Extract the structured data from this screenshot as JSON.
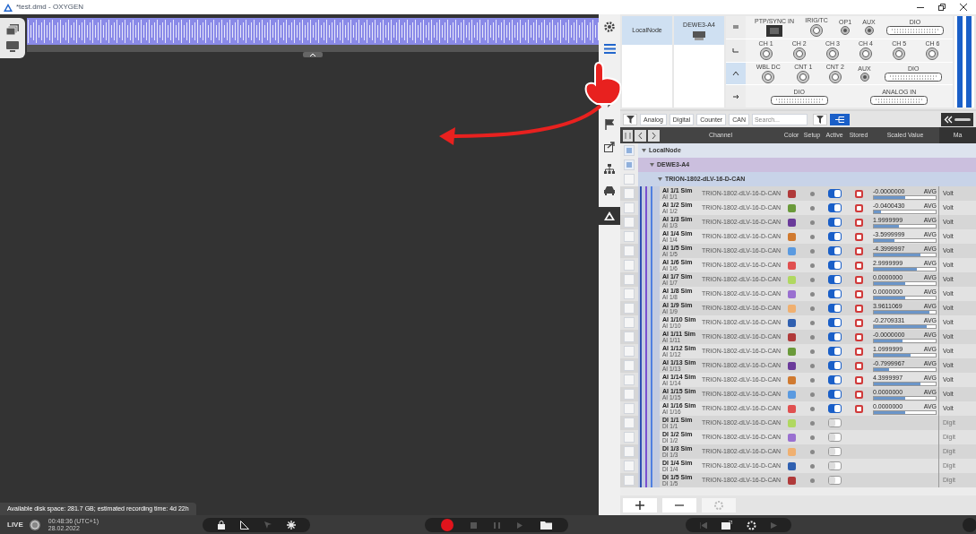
{
  "window": {
    "title": "*test.dmd - OXYGEN"
  },
  "status_text": "Available disk space: 281.7 GB; estimated recording time: 4d 22h",
  "bottom_bar": {
    "live": "LIVE",
    "time": "00:48:36 (UTC+1)",
    "date": "28.02.2022"
  },
  "hardware": {
    "nodes": [
      {
        "label": "LocalNode",
        "selected": true
      },
      {
        "label": "DEWE3-A4",
        "selected": true
      }
    ],
    "slots": [
      {
        "selected": false,
        "connectors": [
          {
            "kind": "ethernet",
            "label": "PTP/SYNC IN"
          },
          {
            "kind": "round",
            "label": "IRIG/TC"
          },
          {
            "kind": "small",
            "label": "OP1"
          },
          {
            "kind": "small",
            "label": "AUX"
          },
          {
            "kind": "sub",
            "label": "DIO"
          }
        ]
      },
      {
        "selected": false,
        "connectors": [
          {
            "kind": "round",
            "label": "CH 1"
          },
          {
            "kind": "round",
            "label": "CH 2"
          },
          {
            "kind": "round",
            "label": "CH 3"
          },
          {
            "kind": "round",
            "label": "CH 4"
          },
          {
            "kind": "round",
            "label": "CH 5"
          },
          {
            "kind": "round",
            "label": "CH 6"
          }
        ]
      },
      {
        "selected": true,
        "connectors": [
          {
            "kind": "round",
            "label": "WBL DC"
          },
          {
            "kind": "round",
            "label": "CNT 1"
          },
          {
            "kind": "round",
            "label": "CNT 2"
          },
          {
            "kind": "small",
            "label": "AUX"
          },
          {
            "kind": "sub",
            "label": "DIO"
          }
        ]
      },
      {
        "selected": false,
        "connectors": [
          {
            "kind": "sub",
            "label": "DIO"
          },
          {
            "kind": "sub",
            "label": "ANALOG IN"
          }
        ]
      }
    ]
  },
  "filters": [
    {
      "label": "Analog"
    },
    {
      "label": "Digital"
    },
    {
      "label": "Counter"
    },
    {
      "label": "CAN"
    }
  ],
  "search": {
    "placeholder": "Search..."
  },
  "columns": [
    "Channel",
    "Color",
    "Setup",
    "Active",
    "Stored",
    "Scaled Value",
    "Ma"
  ],
  "tree": [
    {
      "label": "LocalNode",
      "checked": true
    },
    {
      "label": "DEWE3-A4",
      "checked": true
    },
    {
      "label": "TRION-1802-dLV-16-D-CAN",
      "checked": false
    }
  ],
  "channels": [
    {
      "kind": "analog",
      "name": "AI 1/1 Sim",
      "sub": "AI 1/1",
      "device": "TRION-1802-dLV-16-D-CAN",
      "color": "#b03a3a",
      "checked": false,
      "active": true,
      "stored": true,
      "value": "-0.0000000",
      "unit": "AVG",
      "level": 0.5,
      "type": "Volt"
    },
    {
      "kind": "analog",
      "name": "AI 1/2 Sim",
      "sub": "AI 1/2",
      "device": "TRION-1802-dLV-16-D-CAN",
      "color": "#6a9a3a",
      "checked": false,
      "active": true,
      "stored": true,
      "value": "-0.0400430",
      "unit": "AVG",
      "level": 0.12,
      "type": "Volt"
    },
    {
      "kind": "analog",
      "name": "AI 1/3 Sim",
      "sub": "AI 1/3",
      "device": "TRION-1802-dLV-16-D-CAN",
      "color": "#6a3a9a",
      "checked": false,
      "active": true,
      "stored": true,
      "value": "1.9999999",
      "unit": "AVG",
      "level": 0.4,
      "type": "Volt"
    },
    {
      "kind": "analog",
      "name": "AI 1/4 Sim",
      "sub": "AI 1/4",
      "device": "TRION-1802-dLV-16-D-CAN",
      "color": "#d07a30",
      "checked": false,
      "active": true,
      "stored": true,
      "value": "-3.5999999",
      "unit": "AVG",
      "level": 0.33,
      "type": "Volt"
    },
    {
      "kind": "analog",
      "name": "AI 1/5 Sim",
      "sub": "AI 1/5",
      "device": "TRION-1802-dLV-16-D-CAN",
      "color": "#5a9ae0",
      "checked": false,
      "active": true,
      "stored": true,
      "value": "-4.3999997",
      "unit": "AVG",
      "level": 0.76,
      "type": "Volt"
    },
    {
      "kind": "analog",
      "name": "AI 1/6 Sim",
      "sub": "AI 1/6",
      "device": "TRION-1802-dLV-16-D-CAN",
      "color": "#e05050",
      "checked": false,
      "active": true,
      "stored": true,
      "value": "2.9999999",
      "unit": "AVG",
      "level": 0.7,
      "type": "Volt"
    },
    {
      "kind": "analog",
      "name": "AI 1/7 Sim",
      "sub": "AI 1/7",
      "device": "TRION-1802-dLV-16-D-CAN",
      "color": "#b0d860",
      "checked": false,
      "active": true,
      "stored": true,
      "value": "0.0000000",
      "unit": "AVG",
      "level": 0.5,
      "type": "Volt"
    },
    {
      "kind": "analog",
      "name": "AI 1/8 Sim",
      "sub": "AI 1/8",
      "device": "TRION-1802-dLV-16-D-CAN",
      "color": "#9a70d0",
      "checked": false,
      "active": true,
      "stored": true,
      "value": "0.0000000",
      "unit": "AVG",
      "level": 0.5,
      "type": "Volt"
    },
    {
      "kind": "analog",
      "name": "AI 1/9 Sim",
      "sub": "AI 1/9",
      "device": "TRION-1802-dLV-16-D-CAN",
      "color": "#f0b070",
      "checked": false,
      "active": true,
      "stored": true,
      "value": "3.9611069",
      "unit": "AVG",
      "level": 0.9,
      "type": "Volt"
    },
    {
      "kind": "analog",
      "name": "AI 1/10 Sim",
      "sub": "AI 1/10",
      "device": "TRION-1802-dLV-16-D-CAN",
      "color": "#3060b0",
      "checked": false,
      "active": true,
      "stored": true,
      "value": "-0.2709331",
      "unit": "AVG",
      "level": 0.85,
      "type": "Volt"
    },
    {
      "kind": "analog",
      "name": "AI 1/11 Sim",
      "sub": "AI 1/11",
      "device": "TRION-1802-dLV-16-D-CAN",
      "color": "#b03a3a",
      "checked": false,
      "active": true,
      "stored": true,
      "value": "-0.0000000",
      "unit": "AVG",
      "level": 0.47,
      "type": "Volt"
    },
    {
      "kind": "analog",
      "name": "AI 1/12 Sim",
      "sub": "AI 1/12",
      "device": "TRION-1802-dLV-16-D-CAN",
      "color": "#6a9a3a",
      "checked": false,
      "active": true,
      "stored": true,
      "value": "1.0999999",
      "unit": "AVG",
      "level": 0.6,
      "type": "Volt"
    },
    {
      "kind": "analog",
      "name": "AI 1/13 Sim",
      "sub": "AI 1/13",
      "device": "TRION-1802-dLV-16-D-CAN",
      "color": "#6a3a9a",
      "checked": false,
      "active": true,
      "stored": true,
      "value": "-0.7999967",
      "unit": "AVG",
      "level": 0.25,
      "type": "Volt"
    },
    {
      "kind": "analog",
      "name": "AI 1/14 Sim",
      "sub": "AI 1/14",
      "device": "TRION-1802-dLV-16-D-CAN",
      "color": "#d07a30",
      "checked": false,
      "active": true,
      "stored": true,
      "value": "4.3999997",
      "unit": "AVG",
      "level": 0.75,
      "type": "Volt"
    },
    {
      "kind": "analog",
      "name": "AI 1/15 Sim",
      "sub": "AI 1/15",
      "device": "TRION-1802-dLV-16-D-CAN",
      "color": "#5a9ae0",
      "checked": false,
      "active": true,
      "stored": true,
      "value": "0.0000000",
      "unit": "AVG",
      "level": 0.5,
      "type": "Volt"
    },
    {
      "kind": "analog",
      "name": "AI 1/16 Sim",
      "sub": "AI 1/16",
      "device": "TRION-1802-dLV-16-D-CAN",
      "color": "#e05050",
      "checked": false,
      "active": true,
      "stored": true,
      "value": "0.0000000",
      "unit": "AVG",
      "level": 0.5,
      "type": "Volt"
    },
    {
      "kind": "digital",
      "name": "DI 1/1 Sim",
      "sub": "DI 1/1",
      "device": "TRION-1802-dLV-16-D-CAN",
      "color": "#b0d860",
      "checked": false,
      "active": false,
      "type": "Digit"
    },
    {
      "kind": "digital",
      "name": "DI 1/2 Sim",
      "sub": "DI 1/2",
      "device": "TRION-1802-dLV-16-D-CAN",
      "color": "#9a70d0",
      "checked": false,
      "active": false,
      "type": "Digit"
    },
    {
      "kind": "digital",
      "name": "DI 1/3 Sim",
      "sub": "DI 1/3",
      "device": "TRION-1802-dLV-16-D-CAN",
      "color": "#f0b070",
      "checked": false,
      "active": false,
      "type": "Digit"
    },
    {
      "kind": "digital",
      "name": "DI 1/4 Sim",
      "sub": "DI 1/4",
      "device": "TRION-1802-dLV-16-D-CAN",
      "color": "#3060b0",
      "checked": false,
      "active": false,
      "type": "Digit"
    },
    {
      "kind": "digital",
      "name": "DI 1/5 Sim",
      "sub": "DI 1/5",
      "device": "TRION-1802-dLV-16-D-CAN",
      "color": "#b03a3a",
      "checked": false,
      "active": false,
      "type": "Digit"
    }
  ]
}
